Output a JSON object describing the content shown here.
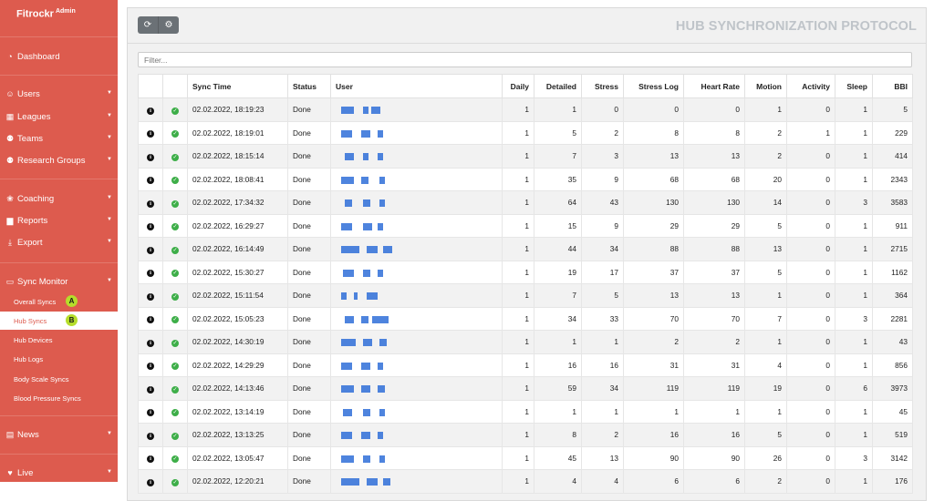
{
  "sidebar": {
    "brand": "Fitrockr",
    "brand_sup": "Admin",
    "items": [
      {
        "label": "Dashboard",
        "icon": "dashboard-icon",
        "caret": false
      },
      {
        "label": "Users",
        "icon": "user-icon",
        "caret": true
      },
      {
        "label": "Leagues",
        "icon": "table-icon",
        "caret": true
      },
      {
        "label": "Teams",
        "icon": "users-icon",
        "caret": true
      },
      {
        "label": "Research Groups",
        "icon": "users-icon",
        "caret": true
      },
      {
        "label": "Coaching",
        "icon": "whistle-icon",
        "caret": true
      },
      {
        "label": "Reports",
        "icon": "bar-chart-icon",
        "caret": true
      },
      {
        "label": "Export",
        "icon": "download-icon",
        "caret": true
      },
      {
        "label": "Sync Monitor",
        "icon": "desktop-icon",
        "caret": true
      },
      {
        "label": "News",
        "icon": "newspaper-icon",
        "caret": true
      },
      {
        "label": "Live",
        "icon": "heart-icon",
        "caret": true
      }
    ],
    "sync_sub": [
      "Overall Syncs",
      "Hub Syncs",
      "Hub Devices",
      "Hub Logs",
      "Body Scale Syncs",
      "Blood Pressure Syncs"
    ],
    "markers": [
      "A",
      "B"
    ]
  },
  "toolbar": {
    "refresh_icon": "refresh-icon",
    "settings_icon": "cogs-icon"
  },
  "page_title": "HUB SYNCHRONIZATION PROTOCOL",
  "filter_placeholder": "Filter...",
  "table": {
    "columns": [
      "",
      "",
      "Sync Time",
      "Status",
      "User",
      "Daily",
      "Detailed",
      "Stress",
      "Stress Log",
      "Heart Rate",
      "Motion",
      "Activity",
      "Sleep",
      "BBI"
    ],
    "rows": [
      [
        "02.02.2022, 18:19:23",
        "Done",
        "1",
        "1",
        "0",
        "0",
        "0",
        "1",
        "0",
        "1",
        "5"
      ],
      [
        "02.02.2022, 18:19:01",
        "Done",
        "1",
        "5",
        "2",
        "8",
        "8",
        "2",
        "1",
        "1",
        "229"
      ],
      [
        "02.02.2022, 18:15:14",
        "Done",
        "1",
        "7",
        "3",
        "13",
        "13",
        "2",
        "0",
        "1",
        "414"
      ],
      [
        "02.02.2022, 18:08:41",
        "Done",
        "1",
        "35",
        "9",
        "68",
        "68",
        "20",
        "0",
        "1",
        "2343"
      ],
      [
        "02.02.2022, 17:34:32",
        "Done",
        "1",
        "64",
        "43",
        "130",
        "130",
        "14",
        "0",
        "3",
        "3583"
      ],
      [
        "02.02.2022, 16:29:27",
        "Done",
        "1",
        "15",
        "9",
        "29",
        "29",
        "5",
        "0",
        "1",
        "911"
      ],
      [
        "02.02.2022, 16:14:49",
        "Done",
        "1",
        "44",
        "34",
        "88",
        "88",
        "13",
        "0",
        "1",
        "2715"
      ],
      [
        "02.02.2022, 15:30:27",
        "Done",
        "1",
        "19",
        "17",
        "37",
        "37",
        "5",
        "0",
        "1",
        "1162"
      ],
      [
        "02.02.2022, 15:11:54",
        "Done",
        "1",
        "7",
        "5",
        "13",
        "13",
        "1",
        "0",
        "1",
        "364"
      ],
      [
        "02.02.2022, 15:05:23",
        "Done",
        "1",
        "34",
        "33",
        "70",
        "70",
        "7",
        "0",
        "3",
        "2281"
      ],
      [
        "02.02.2022, 14:30:19",
        "Done",
        "1",
        "1",
        "1",
        "2",
        "2",
        "1",
        "0",
        "1",
        "43"
      ],
      [
        "02.02.2022, 14:29:29",
        "Done",
        "1",
        "16",
        "16",
        "31",
        "31",
        "4",
        "0",
        "1",
        "856"
      ],
      [
        "02.02.2022, 14:13:46",
        "Done",
        "1",
        "59",
        "34",
        "119",
        "119",
        "19",
        "0",
        "6",
        "3973"
      ],
      [
        "02.02.2022, 13:14:19",
        "Done",
        "1",
        "1",
        "1",
        "1",
        "1",
        "1",
        "0",
        "1",
        "45"
      ],
      [
        "02.02.2022, 13:13:25",
        "Done",
        "1",
        "8",
        "2",
        "16",
        "16",
        "5",
        "0",
        "1",
        "519"
      ],
      [
        "02.02.2022, 13:05:47",
        "Done",
        "1",
        "45",
        "13",
        "90",
        "90",
        "26",
        "0",
        "3",
        "3142"
      ],
      [
        "02.02.2022, 12:20:21",
        "Done",
        "1",
        "4",
        "4",
        "6",
        "6",
        "2",
        "0",
        "1",
        "176"
      ]
    ]
  }
}
